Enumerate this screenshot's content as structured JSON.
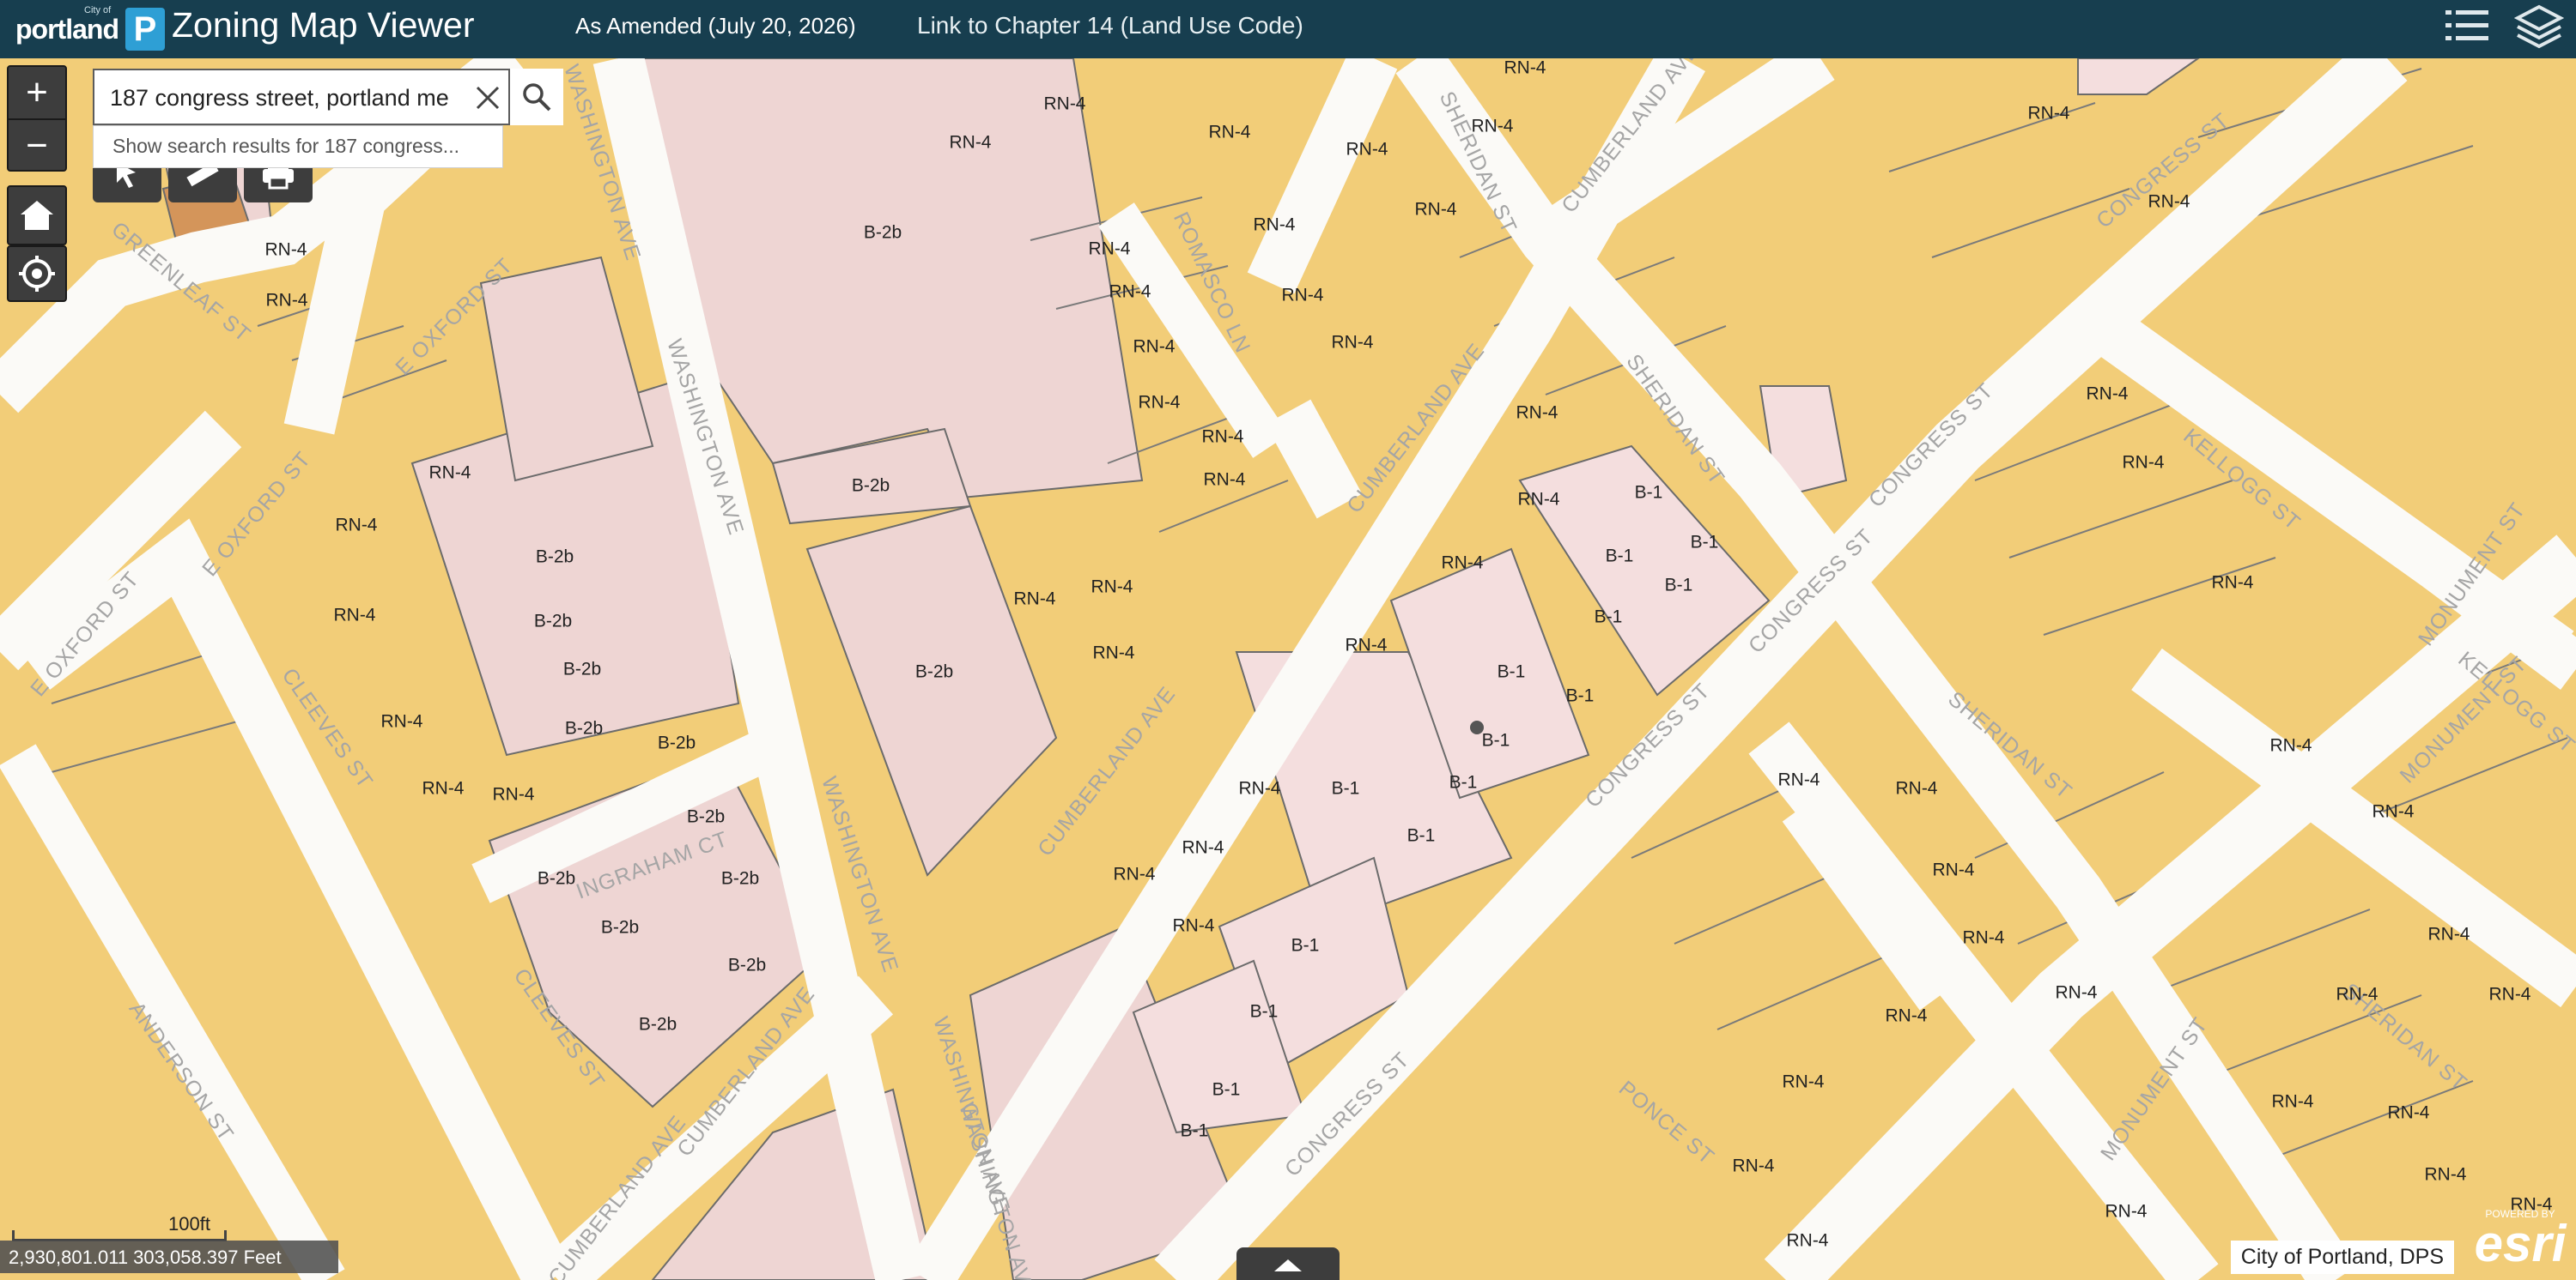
{
  "header": {
    "logo_city": "City of",
    "logo_word": "portland",
    "logo_mark": "P",
    "title": "Zoning Map Viewer",
    "amended": "As Amended (July 20, 2026)",
    "link": "Link to Chapter 14 (Land Use Code)",
    "icons": [
      "legend-list-icon",
      "layers-icon"
    ]
  },
  "controls": {
    "zoom_in": "+",
    "zoom_out": "−",
    "icons": [
      "home-icon",
      "locate-icon",
      "select-tool-icon",
      "measure-tool-icon",
      "print-icon"
    ]
  },
  "search": {
    "value": "187 congress street, portland me",
    "suggestion": "Show search results for 187 congress..."
  },
  "footer": {
    "coordinates": "2,930,801.011 303,058.397 Feet",
    "scale_label": "100ft",
    "attribution": "City of Portland, DPS",
    "esri_powered": "POWERED BY",
    "esri_logo": "esri"
  },
  "colors": {
    "header_bg": "#173e4f",
    "rn4": "#f3cd75",
    "b2b": "#eed5d3",
    "b1": "#f4dede",
    "road": "#fbfaf7",
    "street_label": "#a5a5a5"
  },
  "map": {
    "marker": {
      "zone": "B-1"
    },
    "zones": [
      {
        "name": "RN-4",
        "i": 0
      },
      {
        "name": "RN-4",
        "i": 1
      },
      {
        "name": "RN-4",
        "i": 2
      },
      {
        "name": "RN-4",
        "i": 3
      },
      {
        "name": "RN-4",
        "i": 4
      },
      {
        "name": "RN-4",
        "i": 5
      },
      {
        "name": "RN-4",
        "i": 6
      },
      {
        "name": "RN-4",
        "i": 7
      },
      {
        "name": "RN-4",
        "i": 8
      },
      {
        "name": "RN-4",
        "i": 9
      },
      {
        "name": "RN-4",
        "i": 10
      },
      {
        "name": "RN-4",
        "i": 11
      },
      {
        "name": "RN-4",
        "i": 12
      },
      {
        "name": "RN-4",
        "i": 13
      },
      {
        "name": "RN-4",
        "i": 14
      },
      {
        "name": "B-2b",
        "i": 15
      },
      {
        "name": "B-2b",
        "i": 16
      },
      {
        "name": "B-2b",
        "i": 17
      },
      {
        "name": "B-2b",
        "i": 18
      },
      {
        "name": "B-2b",
        "i": 19
      },
      {
        "name": "B-2b",
        "i": 20
      },
      {
        "name": "B-2b",
        "i": 21
      },
      {
        "name": "B-2b",
        "i": 22
      },
      {
        "name": "B-2b",
        "i": 23
      },
      {
        "name": "B-2b",
        "i": 24
      },
      {
        "name": "B-2b",
        "i": 25
      },
      {
        "name": "B-2b",
        "i": 26
      },
      {
        "name": "B-2b",
        "i": 27
      },
      {
        "name": "B-2b",
        "i": 28
      },
      {
        "name": "B-1",
        "i": 29
      },
      {
        "name": "B-1",
        "i": 30
      },
      {
        "name": "B-1",
        "i": 31
      },
      {
        "name": "B-1",
        "i": 32
      },
      {
        "name": "B-1",
        "i": 33
      },
      {
        "name": "B-1",
        "i": 34
      },
      {
        "name": "B-1",
        "i": 35
      },
      {
        "name": "B-1",
        "i": 36
      },
      {
        "name": "B-1",
        "i": 37
      },
      {
        "name": "B-1",
        "i": 38
      },
      {
        "name": "B-1",
        "i": 39
      },
      {
        "name": "B-1",
        "i": 40
      },
      {
        "name": "B-1",
        "i": 41
      },
      {
        "name": "B-1",
        "i": 42
      },
      {
        "name": "B-1",
        "i": 43
      },
      {
        "name": "RN-4",
        "i": 44
      },
      {
        "name": "RN-4",
        "i": 45
      },
      {
        "name": "RN-4",
        "i": 46
      },
      {
        "name": "RN-4",
        "i": 47
      },
      {
        "name": "RN-4",
        "i": 48
      },
      {
        "name": "RN-4",
        "i": 49
      },
      {
        "name": "RN-4",
        "i": 50
      },
      {
        "name": "RN-4",
        "i": 51
      },
      {
        "name": "RN-4",
        "i": 52
      },
      {
        "name": "RN-4",
        "i": 53
      },
      {
        "name": "RN-4",
        "i": 54
      },
      {
        "name": "RN-4",
        "i": 55
      },
      {
        "name": "RN-4",
        "i": 56
      },
      {
        "name": "RN-4",
        "i": 57
      },
      {
        "name": "RN-4",
        "i": 58
      },
      {
        "name": "RN-4",
        "i": 59
      },
      {
        "name": "RN-4",
        "i": 60
      },
      {
        "name": "RN-4",
        "i": 61
      },
      {
        "name": "RN-4",
        "i": 62
      },
      {
        "name": "RN-4",
        "i": 63
      },
      {
        "name": "RN-4",
        "i": 64
      },
      {
        "name": "RN-4",
        "i": 65
      },
      {
        "name": "RN-4",
        "i": 66
      },
      {
        "name": "RN-4",
        "i": 67
      },
      {
        "name": "RN-4",
        "i": 68
      },
      {
        "name": "RN-4",
        "i": 69
      },
      {
        "name": "RN-4",
        "i": 70
      },
      {
        "name": "RN-4",
        "i": 71
      },
      {
        "name": "RN-4",
        "i": 72
      },
      {
        "name": "RN-4",
        "i": 73
      },
      {
        "name": "RN-4",
        "i": 74
      },
      {
        "name": "RN-4",
        "i": 75
      },
      {
        "name": "RN-4",
        "i": 76
      },
      {
        "name": "RN-4",
        "i": 77
      },
      {
        "name": "RN-4",
        "i": 78
      },
      {
        "name": "RN-4",
        "i": 79
      },
      {
        "name": "RN-4",
        "i": 80
      },
      {
        "name": "RN-4",
        "i": 81
      },
      {
        "name": "RN-4",
        "i": 82
      },
      {
        "name": "RN-4",
        "i": 83
      },
      {
        "name": "RN-4",
        "i": 84
      },
      {
        "name": "RN-4",
        "i": 85
      },
      {
        "name": "RN-4",
        "i": 86
      },
      {
        "name": "RN-4",
        "i": 87
      },
      {
        "name": "RN-4",
        "i": 88
      }
    ],
    "streets": [
      "WASHINGTON AVE",
      "WASHINGTON AVE",
      "WASHINGTON AVE",
      "WASHINGTON AVE",
      "WASHINGTON AVE",
      "CUMBERLAND AVE",
      "CUMBERLAND AVE",
      "CUMBERLAND AVE",
      "CUMBERLAND AVE",
      "CUMBERLAND AVE",
      "CONGRESS ST",
      "CONGRESS ST",
      "CONGRESS ST",
      "CONGRESS ST",
      "CONGRESS ST",
      "SHERIDAN ST",
      "SHERIDAN ST",
      "SHERIDAN ST",
      "SHERIDAN ST",
      "E OXFORD ST",
      "E OXFORD ST",
      "E OXFORD ST",
      "GREENLEAF ST",
      "ROMASCO LN",
      "CLEEVES ST",
      "CLEEVES ST",
      "ANDERSON ST",
      "INGRAHAM CT",
      "KELLOGG ST",
      "KELLOGG ST",
      "MONUMENT ST",
      "MONUMENT ST",
      "MONUMENT ST",
      "PONCE ST"
    ]
  }
}
